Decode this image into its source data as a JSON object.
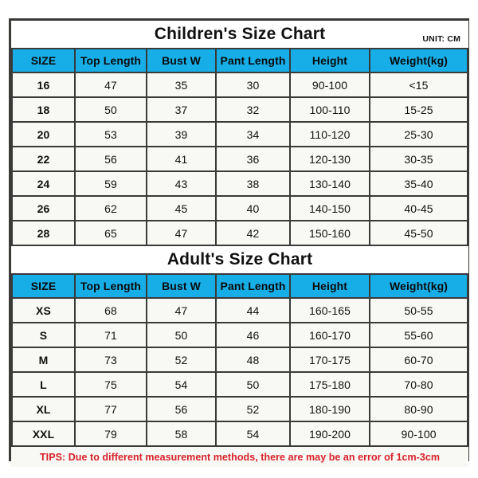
{
  "children": {
    "title": "Children's Size Chart",
    "unit_label": "UNIT: CM",
    "columns": [
      "SIZE",
      "Top Length",
      "Bust W",
      "Pant Length",
      "Height",
      "Weight(kg)"
    ],
    "rows": [
      [
        "16",
        "47",
        "35",
        "30",
        "90-100",
        "<15"
      ],
      [
        "18",
        "50",
        "37",
        "32",
        "100-110",
        "15-25"
      ],
      [
        "20",
        "53",
        "39",
        "34",
        "110-120",
        "25-30"
      ],
      [
        "22",
        "56",
        "41",
        "36",
        "120-130",
        "30-35"
      ],
      [
        "24",
        "59",
        "43",
        "38",
        "130-140",
        "35-40"
      ],
      [
        "26",
        "62",
        "45",
        "40",
        "140-150",
        "40-45"
      ],
      [
        "28",
        "65",
        "47",
        "42",
        "150-160",
        "45-50"
      ]
    ]
  },
  "adults": {
    "title": "Adult's Size Chart",
    "columns": [
      "SIZE",
      "Top Length",
      "Bust W",
      "Pant Length",
      "Height",
      "Weight(kg)"
    ],
    "rows": [
      [
        "XS",
        "68",
        "47",
        "44",
        "160-165",
        "50-55"
      ],
      [
        "S",
        "71",
        "50",
        "46",
        "160-170",
        "55-60"
      ],
      [
        "M",
        "73",
        "52",
        "48",
        "170-175",
        "60-70"
      ],
      [
        "L",
        "75",
        "54",
        "50",
        "175-180",
        "70-80"
      ],
      [
        "XL",
        "77",
        "56",
        "52",
        "180-190",
        "80-90"
      ],
      [
        "XXL",
        "79",
        "58",
        "54",
        "190-200",
        "90-100"
      ]
    ]
  },
  "tips": "TIPS: Due to different measurement methods, there are may be an error of 1cm-3cm",
  "colors": {
    "header_blue": "#17aee8",
    "tips_red": "#d8202a",
    "border": "#3a3a38",
    "cell_bg": "#f8f8f4"
  }
}
